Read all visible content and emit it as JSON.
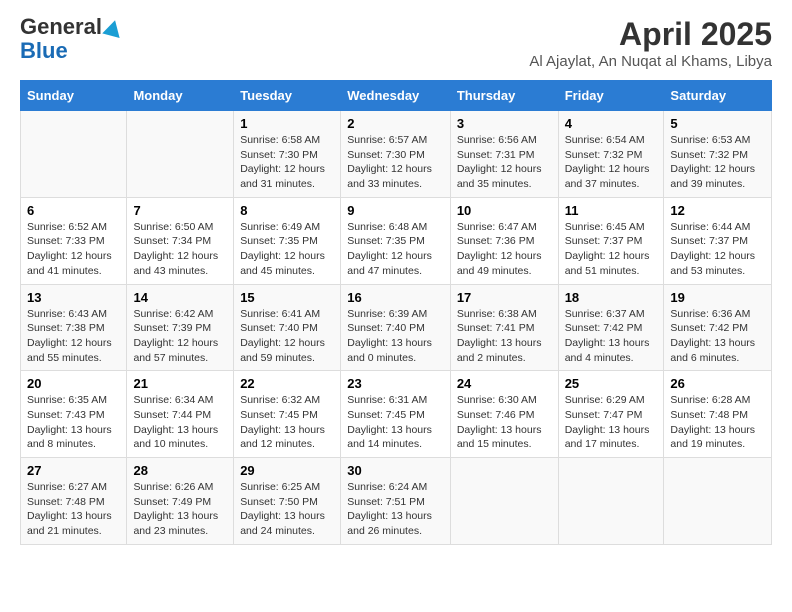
{
  "logo": {
    "general": "General",
    "blue": "Blue"
  },
  "title": "April 2025",
  "subtitle": "Al Ajaylat, An Nuqat al Khams, Libya",
  "days_of_week": [
    "Sunday",
    "Monday",
    "Tuesday",
    "Wednesday",
    "Thursday",
    "Friday",
    "Saturday"
  ],
  "weeks": [
    [
      {
        "day": "",
        "info": ""
      },
      {
        "day": "",
        "info": ""
      },
      {
        "day": "1",
        "info": "Sunrise: 6:58 AM\nSunset: 7:30 PM\nDaylight: 12 hours and 31 minutes."
      },
      {
        "day": "2",
        "info": "Sunrise: 6:57 AM\nSunset: 7:30 PM\nDaylight: 12 hours and 33 minutes."
      },
      {
        "day": "3",
        "info": "Sunrise: 6:56 AM\nSunset: 7:31 PM\nDaylight: 12 hours and 35 minutes."
      },
      {
        "day": "4",
        "info": "Sunrise: 6:54 AM\nSunset: 7:32 PM\nDaylight: 12 hours and 37 minutes."
      },
      {
        "day": "5",
        "info": "Sunrise: 6:53 AM\nSunset: 7:32 PM\nDaylight: 12 hours and 39 minutes."
      }
    ],
    [
      {
        "day": "6",
        "info": "Sunrise: 6:52 AM\nSunset: 7:33 PM\nDaylight: 12 hours and 41 minutes."
      },
      {
        "day": "7",
        "info": "Sunrise: 6:50 AM\nSunset: 7:34 PM\nDaylight: 12 hours and 43 minutes."
      },
      {
        "day": "8",
        "info": "Sunrise: 6:49 AM\nSunset: 7:35 PM\nDaylight: 12 hours and 45 minutes."
      },
      {
        "day": "9",
        "info": "Sunrise: 6:48 AM\nSunset: 7:35 PM\nDaylight: 12 hours and 47 minutes."
      },
      {
        "day": "10",
        "info": "Sunrise: 6:47 AM\nSunset: 7:36 PM\nDaylight: 12 hours and 49 minutes."
      },
      {
        "day": "11",
        "info": "Sunrise: 6:45 AM\nSunset: 7:37 PM\nDaylight: 12 hours and 51 minutes."
      },
      {
        "day": "12",
        "info": "Sunrise: 6:44 AM\nSunset: 7:37 PM\nDaylight: 12 hours and 53 minutes."
      }
    ],
    [
      {
        "day": "13",
        "info": "Sunrise: 6:43 AM\nSunset: 7:38 PM\nDaylight: 12 hours and 55 minutes."
      },
      {
        "day": "14",
        "info": "Sunrise: 6:42 AM\nSunset: 7:39 PM\nDaylight: 12 hours and 57 minutes."
      },
      {
        "day": "15",
        "info": "Sunrise: 6:41 AM\nSunset: 7:40 PM\nDaylight: 12 hours and 59 minutes."
      },
      {
        "day": "16",
        "info": "Sunrise: 6:39 AM\nSunset: 7:40 PM\nDaylight: 13 hours and 0 minutes."
      },
      {
        "day": "17",
        "info": "Sunrise: 6:38 AM\nSunset: 7:41 PM\nDaylight: 13 hours and 2 minutes."
      },
      {
        "day": "18",
        "info": "Sunrise: 6:37 AM\nSunset: 7:42 PM\nDaylight: 13 hours and 4 minutes."
      },
      {
        "day": "19",
        "info": "Sunrise: 6:36 AM\nSunset: 7:42 PM\nDaylight: 13 hours and 6 minutes."
      }
    ],
    [
      {
        "day": "20",
        "info": "Sunrise: 6:35 AM\nSunset: 7:43 PM\nDaylight: 13 hours and 8 minutes."
      },
      {
        "day": "21",
        "info": "Sunrise: 6:34 AM\nSunset: 7:44 PM\nDaylight: 13 hours and 10 minutes."
      },
      {
        "day": "22",
        "info": "Sunrise: 6:32 AM\nSunset: 7:45 PM\nDaylight: 13 hours and 12 minutes."
      },
      {
        "day": "23",
        "info": "Sunrise: 6:31 AM\nSunset: 7:45 PM\nDaylight: 13 hours and 14 minutes."
      },
      {
        "day": "24",
        "info": "Sunrise: 6:30 AM\nSunset: 7:46 PM\nDaylight: 13 hours and 15 minutes."
      },
      {
        "day": "25",
        "info": "Sunrise: 6:29 AM\nSunset: 7:47 PM\nDaylight: 13 hours and 17 minutes."
      },
      {
        "day": "26",
        "info": "Sunrise: 6:28 AM\nSunset: 7:48 PM\nDaylight: 13 hours and 19 minutes."
      }
    ],
    [
      {
        "day": "27",
        "info": "Sunrise: 6:27 AM\nSunset: 7:48 PM\nDaylight: 13 hours and 21 minutes."
      },
      {
        "day": "28",
        "info": "Sunrise: 6:26 AM\nSunset: 7:49 PM\nDaylight: 13 hours and 23 minutes."
      },
      {
        "day": "29",
        "info": "Sunrise: 6:25 AM\nSunset: 7:50 PM\nDaylight: 13 hours and 24 minutes."
      },
      {
        "day": "30",
        "info": "Sunrise: 6:24 AM\nSunset: 7:51 PM\nDaylight: 13 hours and 26 minutes."
      },
      {
        "day": "",
        "info": ""
      },
      {
        "day": "",
        "info": ""
      },
      {
        "day": "",
        "info": ""
      }
    ]
  ]
}
